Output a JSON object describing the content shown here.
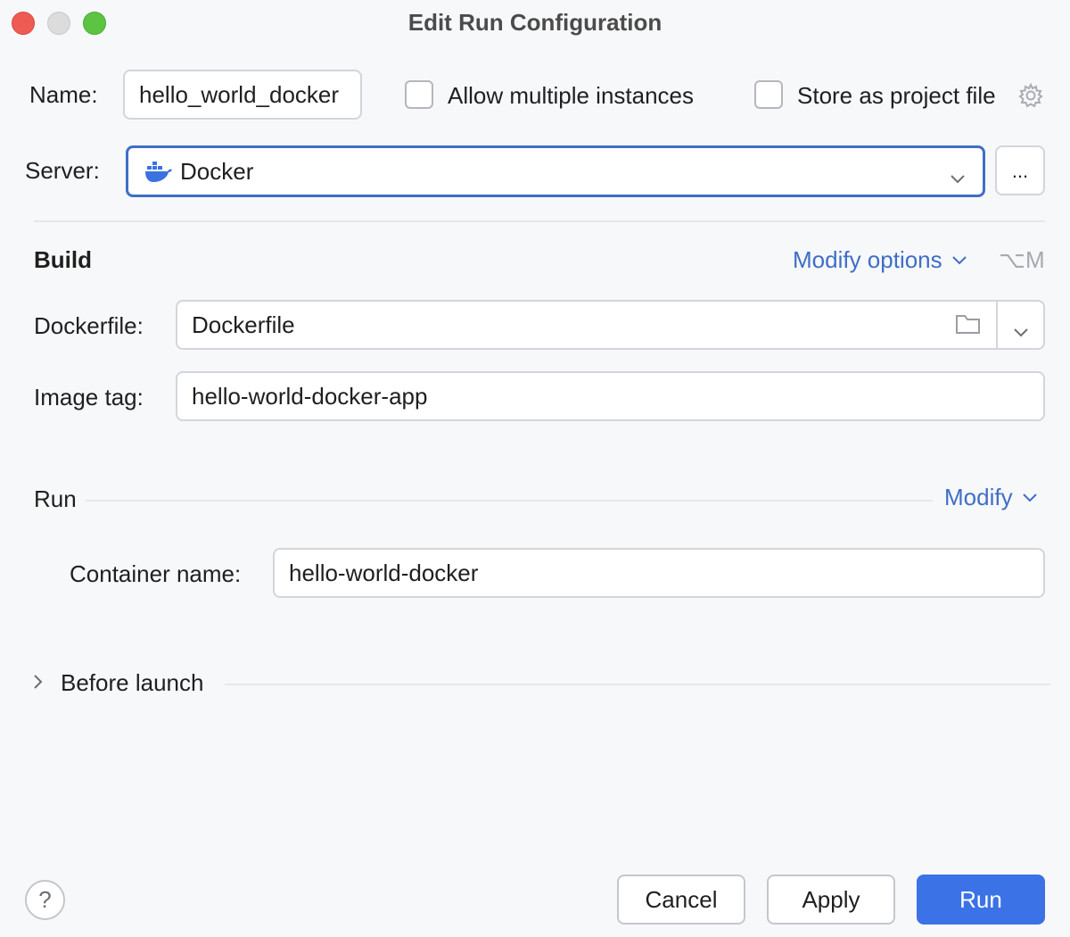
{
  "window": {
    "title": "Edit Run Configuration"
  },
  "name_row": {
    "label": "Name:",
    "value": "hello_world_docker",
    "allow_multiple": {
      "label": "Allow multiple instances",
      "checked": false
    },
    "store_project": {
      "label": "Store as project file",
      "checked": false
    },
    "settings_icon": "gear-icon"
  },
  "server_row": {
    "label": "Server:",
    "value": "Docker",
    "icon": "docker-icon",
    "browse_label": "..."
  },
  "build": {
    "heading": "Build",
    "modify_options_label": "Modify options",
    "shortcut": "⌥M",
    "dockerfile": {
      "label": "Dockerfile:",
      "value": "Dockerfile"
    },
    "image_tag": {
      "label": "Image tag:",
      "value": "hello-world-docker-app"
    }
  },
  "run": {
    "heading": "Run",
    "modify_label": "Modify",
    "container_name": {
      "label": "Container name:",
      "value": "hello-world-docker"
    }
  },
  "before_launch": {
    "label": "Before launch",
    "expanded": false
  },
  "footer": {
    "help_label": "?",
    "cancel_label": "Cancel",
    "apply_label": "Apply",
    "run_label": "Run"
  },
  "colors": {
    "accent": "#3b72e6",
    "link": "#3f6ec7",
    "focus_border": "#3f6ec7",
    "background": "#f7f8fa"
  }
}
